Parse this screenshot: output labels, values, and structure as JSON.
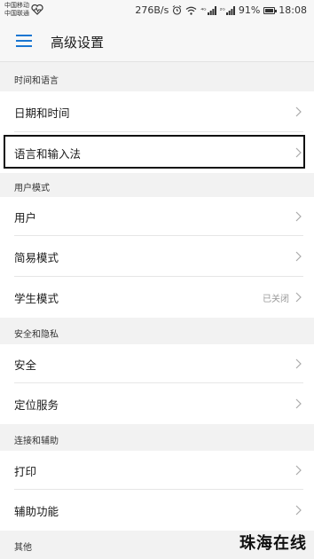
{
  "status_bar": {
    "carrier_1": "中国移动",
    "carrier_2": "中国联通",
    "speed": "276B/s",
    "signal_1": "⁴ᴳ",
    "signal_2": "²ᴳ",
    "battery": "91%",
    "time": "18:08"
  },
  "header": {
    "title": "高级设置"
  },
  "sections": {
    "time_language": "时间和语言",
    "user_mode": "用户模式",
    "security_privacy": "安全和隐私",
    "connect_assist": "连接和辅助",
    "other": "其他"
  },
  "items": {
    "date_time": "日期和时间",
    "language_input": "语言和输入法",
    "user": "用户",
    "simple_mode": "简易模式",
    "student_mode": "学生模式",
    "student_mode_value": "已关闭",
    "security": "安全",
    "location": "定位服务",
    "print": "打印",
    "accessibility": "辅助功能"
  },
  "watermark": "珠海在线",
  "colors": {
    "accent": "#1976d2",
    "background": "#f2f2f2"
  }
}
